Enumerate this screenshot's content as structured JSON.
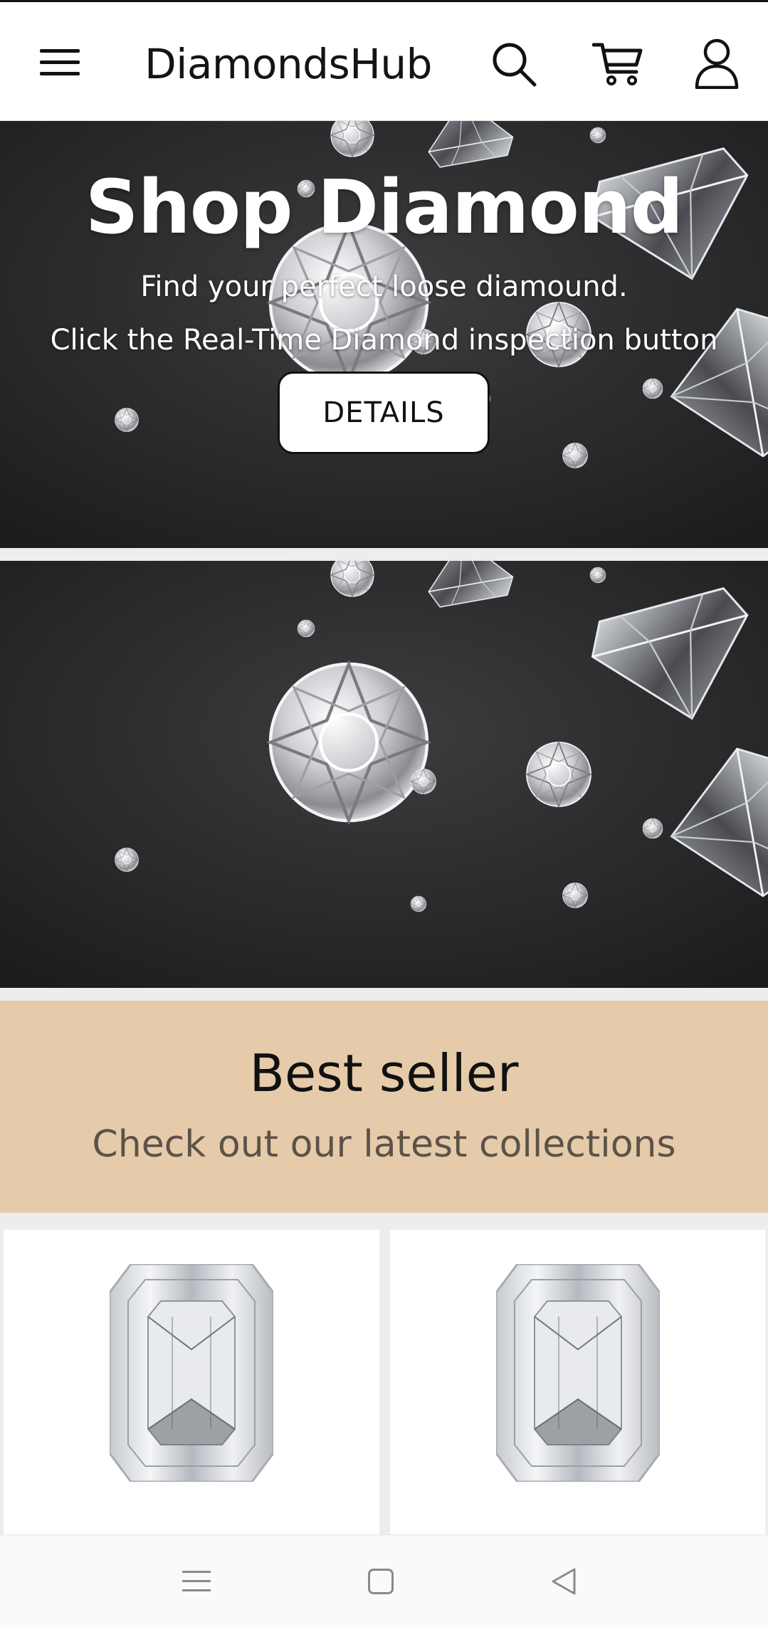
{
  "app_bar": {
    "brand": "DiamondsHub",
    "icons": [
      "menu-icon",
      "search-icon",
      "cart-icon",
      "user-icon"
    ]
  },
  "hero": {
    "title": "Shop Diamond",
    "line1": "Find your perfect loose diamound.",
    "line2": "Click the Real-Time Diamond inspection button",
    "button_label": "DETAILS"
  },
  "best_seller": {
    "title": "Best seller",
    "subtitle": "Check out our latest collections"
  },
  "products": [
    {
      "image": "emerald-cut-diamond"
    },
    {
      "image": "emerald-cut-diamond"
    }
  ],
  "system_nav": {
    "icons": [
      "recent-apps-icon",
      "home-icon",
      "back-icon"
    ]
  },
  "colors": {
    "app_bar_bg": "#ffffff",
    "banner_bg": "#2a2a2b",
    "best_seller_bg": "#e5cbaa",
    "best_seller_subtitle": "#5c5248",
    "page_bg": "#ededed"
  }
}
